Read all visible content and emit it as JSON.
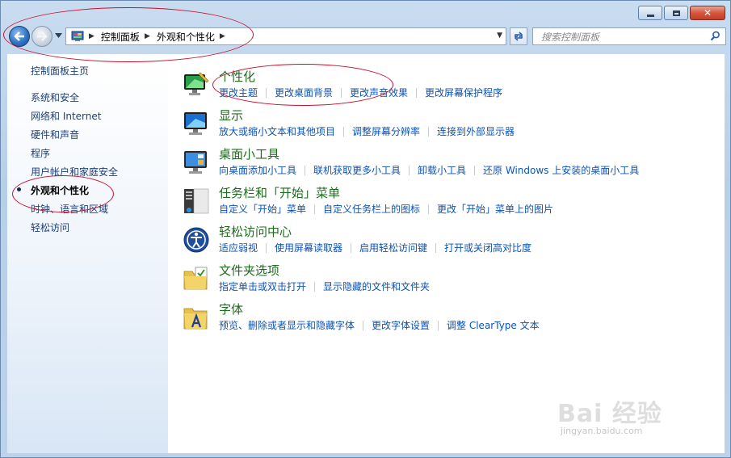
{
  "search": {
    "placeholder": "搜索控制面板"
  },
  "breadcrumb": [
    "控制面板",
    "外观和个性化"
  ],
  "sidebar": {
    "items": [
      {
        "label": "控制面板主页"
      },
      {
        "label": "系统和安全"
      },
      {
        "label": "网络和 Internet"
      },
      {
        "label": "硬件和声音"
      },
      {
        "label": "程序"
      },
      {
        "label": "用户帐户和家庭安全"
      },
      {
        "label": "外观和个性化",
        "current": true
      },
      {
        "label": "时钟、语言和区域"
      },
      {
        "label": "轻松访问"
      }
    ]
  },
  "categories": [
    {
      "icon": "personalization-icon",
      "title": "个性化",
      "links": [
        "更改主题",
        "更改桌面背景",
        "更改声音效果",
        "更改屏幕保护程序"
      ]
    },
    {
      "icon": "display-icon",
      "title": "显示",
      "links": [
        "放大或缩小文本和其他项目",
        "调整屏幕分辨率",
        "连接到外部显示器"
      ]
    },
    {
      "icon": "gadgets-icon",
      "title": "桌面小工具",
      "links": [
        "向桌面添加小工具",
        "联机获取更多小工具",
        "卸载小工具",
        "还原 Windows 上安装的桌面小工具"
      ]
    },
    {
      "icon": "taskbar-icon",
      "title": "任务栏和「开始」菜单",
      "links": [
        "自定义「开始」菜单",
        "自定义任务栏上的图标",
        "更改「开始」菜单上的图片"
      ]
    },
    {
      "icon": "ease-of-access-icon",
      "title": "轻松访问中心",
      "links": [
        "适应弱视",
        "使用屏幕读取器",
        "启用轻松访问键",
        "打开或关闭高对比度"
      ]
    },
    {
      "icon": "folder-options-icon",
      "title": "文件夹选项",
      "links": [
        "指定单击或双击打开",
        "显示隐藏的文件和文件夹"
      ]
    },
    {
      "icon": "fonts-icon",
      "title": "字体",
      "links": [
        "预览、删除或者显示和隐藏字体",
        "更改字体设置",
        "调整 ClearType 文本"
      ]
    }
  ],
  "watermark": {
    "brand": "Bai 经验",
    "url": "jingyan.baidu.com"
  },
  "colors": {
    "link": "#0b53b8",
    "category_title": "#1e6a1e",
    "sidebar_link": "#1d3f78",
    "annotation": "#c8102e"
  }
}
